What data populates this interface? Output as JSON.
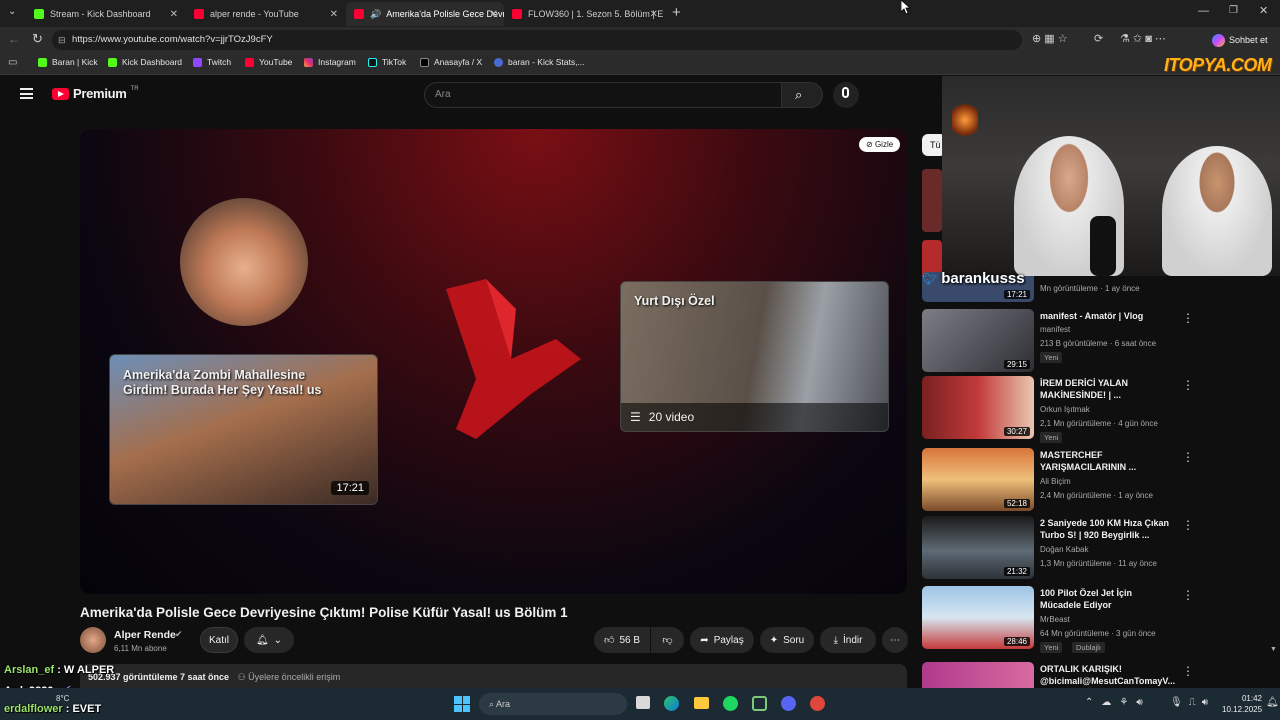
{
  "browser": {
    "tabs": [
      {
        "label": "Stream - Kick Dashboard",
        "color": "#53fc18"
      },
      {
        "label": "alper rende - YouTube",
        "color": "#ff0033"
      },
      {
        "label": "Amerika'da Polisle Gece Devri",
        "color": "#ff0033"
      },
      {
        "label": "FLOW360 | 1. Sezon 5. Bölüm | EL",
        "color": "#ff0033"
      }
    ],
    "url": "https://www.youtube.com/watch?v=jjrTOzJ9cFY",
    "chat_button": "Sohbet et",
    "bookmarks": [
      "Baran | Kick",
      "Kick Dashboard",
      "Twitch",
      "YouTube",
      "Instagram",
      "TikTok",
      "Anasayfa / X",
      "baran - Kick Stats,..."
    ]
  },
  "overlay_logo": "ITOPYA.COM",
  "streamer_name": "barankusss",
  "youtube": {
    "brand": "Premium",
    "brand_sup": "TR",
    "search_placeholder": "Ara",
    "player": {
      "hide_label": "Gizle",
      "card_left_title": "Amerika'da Zombi Mahallesine Girdim! Burada Her Şey Yasal! us",
      "card_left_duration": "17:21",
      "card_right_title": "Yurt Dışı Özel",
      "card_right_count": "20 video"
    },
    "video_title": "Amerika'da Polisle Gece Devriyesine Çıktım! Polise Küfür Yasal! us Bölüm 1",
    "channel": {
      "name": "Alper Rende",
      "subs": "6,11 Mn abone",
      "join": "Katıl"
    },
    "actions": {
      "likes": "56 B",
      "share": "Paylaş",
      "ask": "Soru",
      "download": "İndir"
    },
    "views_line": "502.937 görüntüleme  7 saat önce",
    "members_line": "Üyelere öncelikli erişim",
    "filter_chip": "Tü",
    "sidebar": [
      {
        "title": "",
        "channel": "",
        "meta": "Mn görüntüleme · 1 ay önce",
        "duration": "17:21",
        "badge": "",
        "thumb": "#394a6b"
      },
      {
        "title": "manifest - Amatör | Vlog",
        "channel": "manifest",
        "meta": "213 B görüntüleme · 6 saat önce",
        "duration": "29:15",
        "badge": "Yeni",
        "thumb": "#5b5b63"
      },
      {
        "title": "İREM DERİCİ YALAN MAKİNESİNDE! | ...",
        "channel": "Orkun Işıtmak",
        "meta": "2,1 Mn görüntüleme · 4 gün önce",
        "duration": "30:27",
        "badge": "Yeni",
        "thumb": "#8a2a2a"
      },
      {
        "title": "MASTERCHEF YARIŞMACILARININ ...",
        "channel": "Ali Biçim",
        "meta": "2,4 Mn görüntüleme · 1 ay önce",
        "duration": "52:18",
        "badge": "",
        "thumb": "#c45c2a"
      },
      {
        "title": "2 Saniyede 100 KM Hıza Çıkan Turbo S! | 920 Beygirlik ...",
        "channel": "Doğan Kabak",
        "meta": "1,3 Mn görüntüleme · 11 ay önce",
        "duration": "21:32",
        "badge": "",
        "thumb": "#2e3a46"
      },
      {
        "title": "100 Pilot Özel Jet İçin Mücadele Ediyor",
        "channel": "MrBeast",
        "meta": "64 Mn görüntüleme · 3 gün önce",
        "duration": "28:46",
        "badge": "Yeni",
        "badge2": "Dublajlı",
        "thumb": "#8fb3d6"
      },
      {
        "title": "ORTALIK KARIŞIK! @bicimali@MesutCanTomayV...",
        "channel": "",
        "meta": "",
        "duration": "",
        "badge": "",
        "thumb": "#b03a8c"
      }
    ]
  },
  "chat": [
    {
      "user": "Arslan_ef",
      "msg": "W ALPER"
    },
    {
      "user": "Arda9820",
      "msg": ""
    },
    {
      "user": "erdalflower",
      "msg": "EVET"
    }
  ],
  "taskbar": {
    "search": "Ara",
    "weather": "8°C",
    "time": "01:42",
    "date": "10.12.2025"
  }
}
